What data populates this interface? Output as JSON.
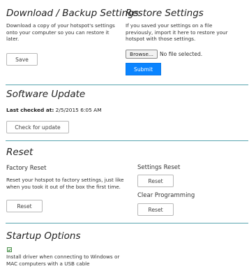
{
  "download_backup": {
    "title": "Download / Backup Settings",
    "description": "Download a copy of your hotspot's settings onto your computer so you can restore it later.",
    "save_label": "Save"
  },
  "restore": {
    "title": "Restore Settings",
    "description": "If you saved your settings on a file previously, import it here to restore your hotspot with those settings.",
    "browse_label": "Browse...",
    "file_status": "No file selected.",
    "submit_label": "Submit"
  },
  "software_update": {
    "title": "Software Update",
    "last_checked_label": "Last checked at:",
    "last_checked_value": "2/5/2015 6:05 AM",
    "check_button": "Check for update"
  },
  "reset": {
    "title": "Reset",
    "factory_label": "Factory Reset",
    "factory_description": "Reset your hotspot to factory settings, just like when you took it out of the box the first time.",
    "factory_button": "Reset",
    "settings_label": "Settings Reset",
    "settings_button": "Reset",
    "clear_label": "Clear Programming",
    "clear_button": "Reset"
  },
  "startup": {
    "title": "Startup Options",
    "install_driver_checked": true,
    "install_driver_text": "Install driver when connecting to Windows or MAC computers with a USB cable"
  },
  "colors": {
    "accent": "#0a84ff",
    "divider": "#5aa6b0",
    "checkbox_check": "#3a8a3a"
  }
}
